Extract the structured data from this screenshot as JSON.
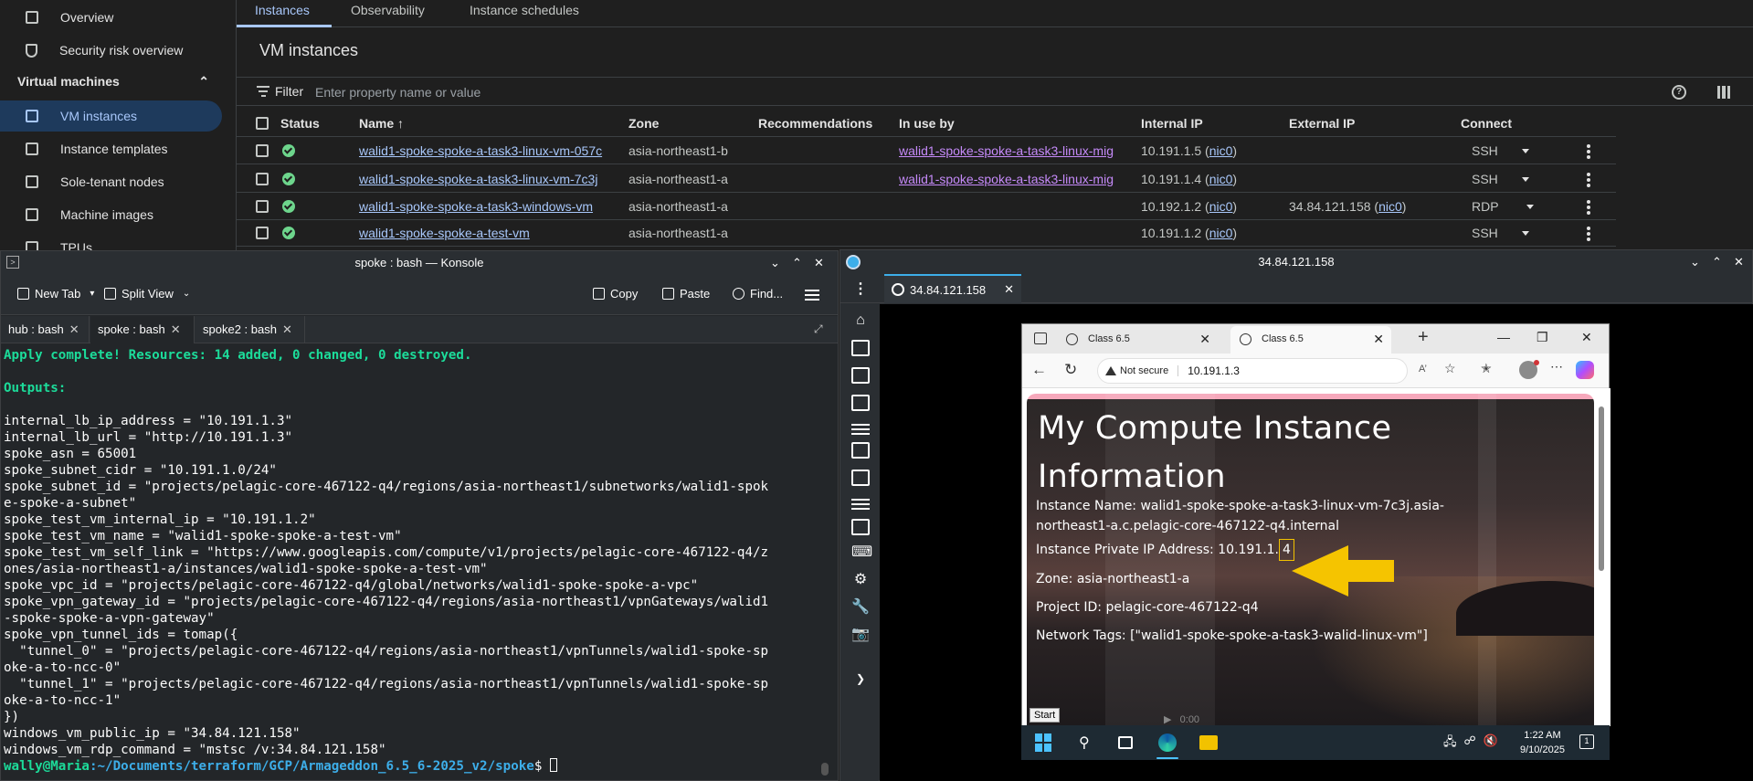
{
  "gcp": {
    "sidebar": {
      "overview": "Overview",
      "security_risk": "Security risk overview",
      "section_title": "Virtual machines",
      "vm_instances": "VM instances",
      "instance_templates": "Instance templates",
      "sole_tenant": "Sole-tenant nodes",
      "machine_images": "Machine images",
      "tpus": "TPUs"
    },
    "tabs": [
      "Instances",
      "Observability",
      "Instance schedules"
    ],
    "page_title": "VM instances",
    "filter_label": "Filter",
    "filter_placeholder": "Enter property name or value",
    "columns": [
      "Status",
      "Name",
      "Zone",
      "Recommendations",
      "In use by",
      "Internal IP",
      "External IP",
      "Connect"
    ],
    "rows": [
      {
        "name": "walid1-spoke-spoke-a-task3-linux-vm-057c",
        "zone": "asia-northeast1-b",
        "in_use_by": "walid1-spoke-spoke-a-task3-linux-mig",
        "internal_ip": "10.191.1.5",
        "internal_nic": "nic0",
        "external_ip": "",
        "external_nic": "",
        "connect": "SSH"
      },
      {
        "name": "walid1-spoke-spoke-a-task3-linux-vm-7c3j",
        "zone": "asia-northeast1-a",
        "in_use_by": "walid1-spoke-spoke-a-task3-linux-mig",
        "internal_ip": "10.191.1.4",
        "internal_nic": "nic0",
        "external_ip": "",
        "external_nic": "",
        "connect": "SSH"
      },
      {
        "name": "walid1-spoke-spoke-a-task3-windows-vm",
        "zone": "asia-northeast1-a",
        "in_use_by": "",
        "internal_ip": "10.192.1.2",
        "internal_nic": "nic0",
        "external_ip": "34.84.121.158",
        "external_nic": "nic0",
        "connect": "RDP"
      },
      {
        "name": "walid1-spoke-spoke-a-test-vm",
        "zone": "asia-northeast1-a",
        "in_use_by": "",
        "internal_ip": "10.191.1.2",
        "internal_nic": "nic0",
        "external_ip": "",
        "external_nic": "",
        "connect": "SSH"
      }
    ]
  },
  "konsole": {
    "title": "spoke : bash — Konsole",
    "toolbar": {
      "new_tab": "New Tab",
      "split_view": "Split View",
      "copy": "Copy",
      "paste": "Paste",
      "find": "Find..."
    },
    "tabs": [
      "hub : bash",
      "spoke : bash",
      "spoke2 : bash"
    ],
    "active_tab": 1,
    "terminal": {
      "apply_line": "Apply complete! Resources: 14 added, 0 changed, 0 destroyed.",
      "outputs_label": "Outputs:",
      "lines": [
        "internal_lb_ip_address = \"10.191.1.3\"",
        "internal_lb_url = \"http://10.191.1.3\"",
        "spoke_asn = 65001",
        "spoke_subnet_cidr = \"10.191.1.0/24\"",
        "spoke_subnet_id = \"projects/pelagic-core-467122-q4/regions/asia-northeast1/subnetworks/walid1-spok",
        "e-spoke-a-subnet\"",
        "spoke_test_vm_internal_ip = \"10.191.1.2\"",
        "spoke_test_vm_name = \"walid1-spoke-spoke-a-test-vm\"",
        "spoke_test_vm_self_link = \"https://www.googleapis.com/compute/v1/projects/pelagic-core-467122-q4/z",
        "ones/asia-northeast1-a/instances/walid1-spoke-spoke-a-test-vm\"",
        "spoke_vpc_id = \"projects/pelagic-core-467122-q4/global/networks/walid1-spoke-spoke-a-vpc\"",
        "spoke_vpn_gateway_id = \"projects/pelagic-core-467122-q4/regions/asia-northeast1/vpnGateways/walid1",
        "-spoke-spoke-a-vpn-gateway\"",
        "spoke_vpn_tunnel_ids = tomap({",
        "  \"tunnel_0\" = \"projects/pelagic-core-467122-q4/regions/asia-northeast1/vpnTunnels/walid1-spoke-sp",
        "oke-a-to-ncc-0\"",
        "  \"tunnel_1\" = \"projects/pelagic-core-467122-q4/regions/asia-northeast1/vpnTunnels/walid1-spoke-sp",
        "oke-a-to-ncc-1\"",
        "})",
        "windows_vm_public_ip = \"34.84.121.158\"",
        "windows_vm_rdp_command = \"mstsc /v:34.84.121.158\""
      ],
      "prompt_user": "wally@Maria",
      "prompt_path": ":~/Documents/terraform/GCP/Armageddon_6.5_6-2025_v2/spoke",
      "prompt_symbol": "$ "
    }
  },
  "rdp": {
    "window_title": "34.84.121.158",
    "tab_label": "34.84.121.158",
    "browser": {
      "tabs": [
        "Class 6.5",
        "Class 6.5"
      ],
      "not_secure": "Not secure",
      "url": "10.191.1.3",
      "page": {
        "heading": "My Compute Instance Information",
        "instance_name_label": "Instance Name:",
        "instance_name_value": "walid1-spoke-spoke-a-task3-linux-vm-7c3j.asia-northeast1-a.c.pelagic-core-467122-q4.internal",
        "private_ip_label": "Instance Private IP Address:",
        "private_ip_prefix": "10.191.1.",
        "private_ip_last": "4",
        "zone_label": "Zone:",
        "zone_value": "asia-northeast1-a",
        "project_label": "Project ID:",
        "project_value": "pelagic-core-467122-q4",
        "tags_label": "Network Tags:",
        "tags_value": "[\"walid1-spoke-spoke-a-task3-walid-linux-vm\"]",
        "video_time": "0:00"
      },
      "arrow_color": "#f5c400"
    },
    "taskbar": {
      "start_tooltip": "Start",
      "time": "1:22 AM",
      "date": "9/10/2025",
      "notification_count": "1"
    }
  }
}
